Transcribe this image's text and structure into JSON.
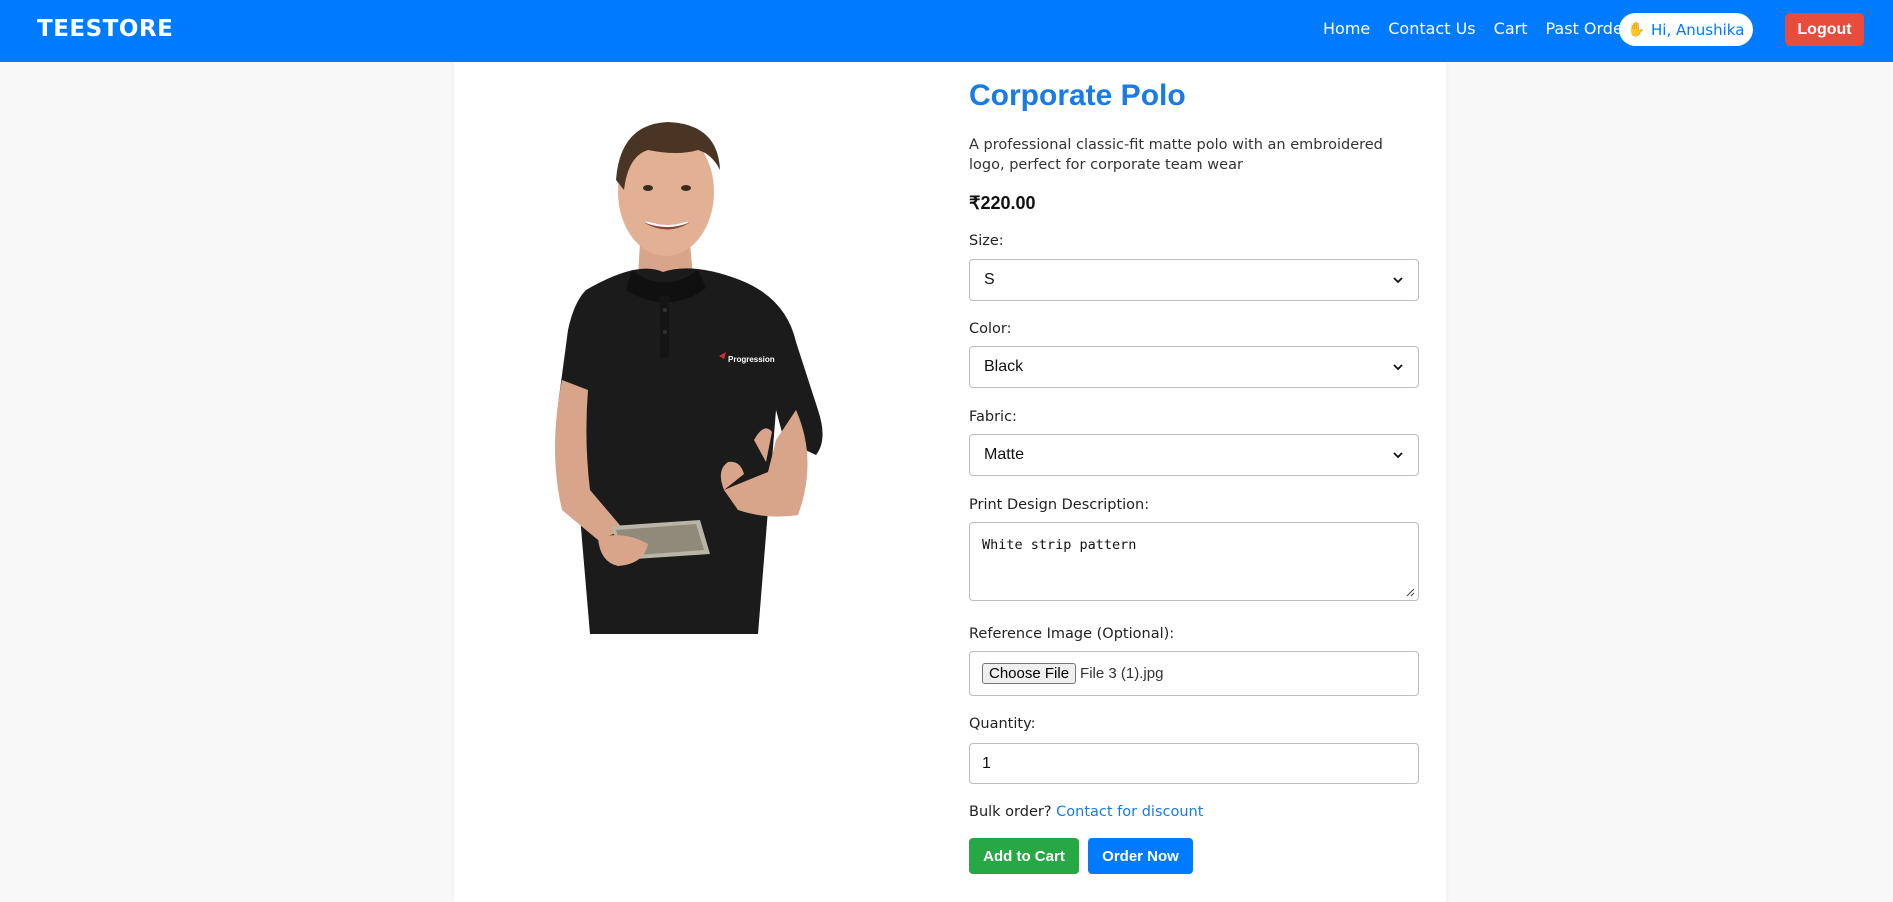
{
  "navbar": {
    "brand": "TEESTORE",
    "links": [
      "Home",
      "Contact Us",
      "Cart",
      "Past Orders"
    ],
    "greeting_icon": "waving-hand-icon",
    "greeting": "Hi, Anushika",
    "logout_label": "Logout",
    "colors": {
      "bar": "#007bff",
      "logout": "#e74c3c"
    }
  },
  "product": {
    "image": "black-polo-model",
    "title": "Corporate Polo",
    "description": "A professional classic-fit matte polo with an embroidered logo, perfect for corporate team wear",
    "price": "₹220.00",
    "shirt_logo": "Progression"
  },
  "form": {
    "size": {
      "label": "Size:",
      "value": "S"
    },
    "color": {
      "label": "Color:",
      "value": "Black"
    },
    "fabric": {
      "label": "Fabric:",
      "value": "Matte"
    },
    "print_design": {
      "label": "Print Design Description:",
      "value": "White strip pattern"
    },
    "reference_image": {
      "label": "Reference Image (Optional):",
      "button": "Choose File",
      "file_name": "File 3 (1).jpg"
    },
    "quantity": {
      "label": "Quantity:",
      "value": "1"
    },
    "bulk": {
      "text": "Bulk order? ",
      "link": "Contact for discount"
    },
    "add_to_cart": "Add to Cart",
    "order_now": "Order Now",
    "colors": {
      "add_to_cart": "#28a745",
      "order_now": "#007bff",
      "title": "#1a7ae6"
    }
  }
}
